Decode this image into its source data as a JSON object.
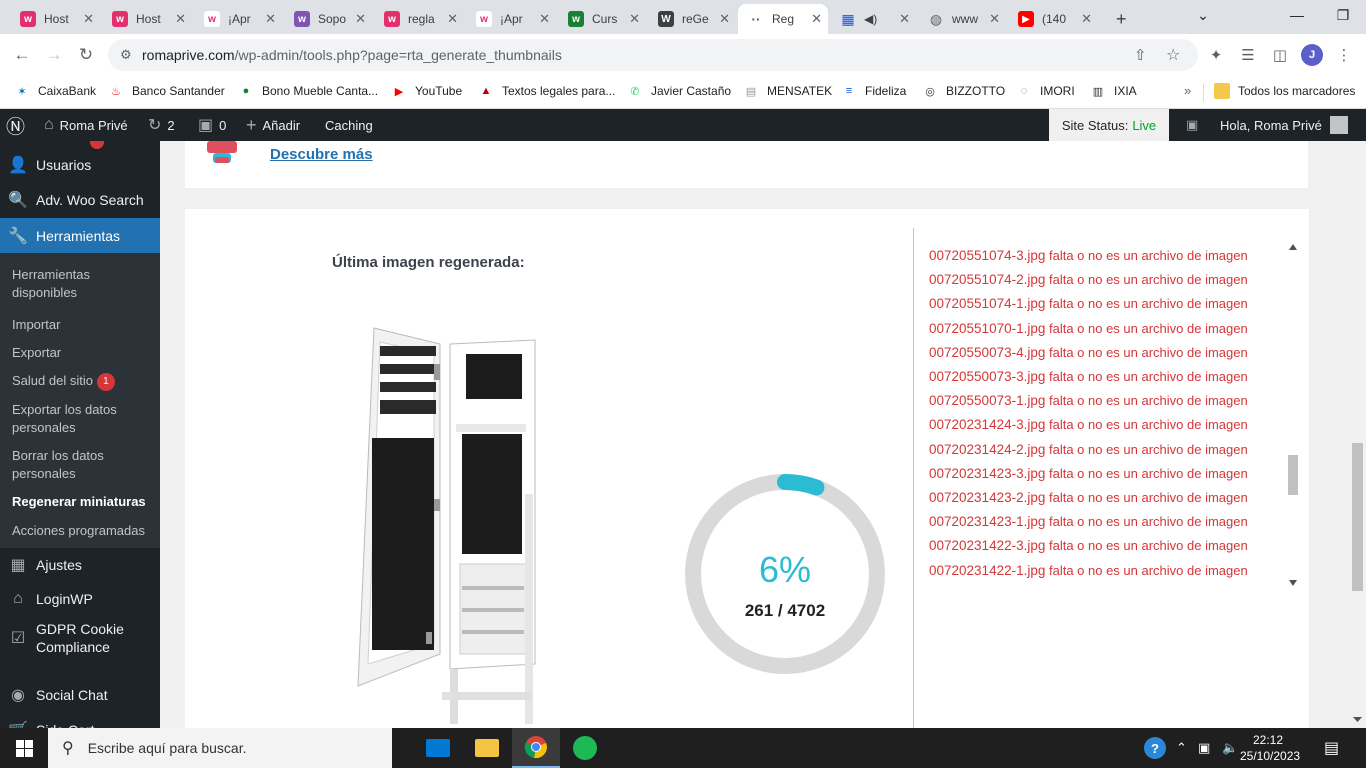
{
  "browser": {
    "tabs": [
      {
        "label": "Host",
        "favicon": "woo-icon",
        "color": "#e1306c"
      },
      {
        "label": "Host",
        "favicon": "woo-icon",
        "color": "#e1306c"
      },
      {
        "label": "¡Apr",
        "favicon": "woo-icon",
        "color": "#ffffff"
      },
      {
        "label": "Sopo",
        "favicon": "woo-icon",
        "color": "#7f54b3"
      },
      {
        "label": "regla",
        "favicon": "woo-icon",
        "color": "#e1306c"
      },
      {
        "label": "¡Apr",
        "favicon": "woo-icon",
        "color": "#ffffff"
      },
      {
        "label": "Curs",
        "favicon": "woo-icon",
        "color": "#1a7f37"
      },
      {
        "label": "reGe",
        "favicon": "wordpress-icon",
        "color": "#3c4043"
      },
      {
        "label": "Reg",
        "favicon": "loading-icon",
        "color": "#ffffff",
        "active": true
      },
      {
        "label": "",
        "favicon": "grid-icon",
        "color": "#1a56db"
      },
      {
        "label": "www",
        "favicon": "globe-icon",
        "color": "#5f6368"
      },
      {
        "label": "(140",
        "favicon": "youtube-icon",
        "color": "#ff0000"
      }
    ],
    "url_host": "romaprive.com",
    "url_path": "/wp-admin/tools.php?page=rta_generate_thumbnails"
  },
  "bookmarks": [
    {
      "label": "CaixaBank",
      "icon": "caixabank-icon",
      "color": "#0070b8"
    },
    {
      "label": "Banco Santander",
      "icon": "santander-icon",
      "color": "#ec0000"
    },
    {
      "label": "Bono Mueble Canta...",
      "icon": "bono-icon",
      "color": "#1a7f37"
    },
    {
      "label": "YouTube",
      "icon": "youtube-icon",
      "color": "#ff0000"
    },
    {
      "label": "Textos legales para...",
      "icon": "legal-icon",
      "color": "#c00000"
    },
    {
      "label": "Javier Castaño",
      "icon": "whatsapp-icon",
      "color": "#25d366"
    },
    {
      "label": "MENSATEK",
      "icon": "mensatek-icon",
      "color": "#999999"
    },
    {
      "label": "Fideliza",
      "icon": "fideliza-icon",
      "color": "#1a56db"
    },
    {
      "label": "BIZZOTTO",
      "icon": "bizzotto-icon",
      "color": "#333333"
    },
    {
      "label": "IMORI",
      "icon": "imori-icon",
      "color": "#666666"
    },
    {
      "label": "IXIA",
      "icon": "ixia-icon",
      "color": "#333333"
    }
  ],
  "bookmarks_all": "Todos los marcadores",
  "adminbar": {
    "site_name": "Roma Privé",
    "updates": "2",
    "comments": "0",
    "add_new": "Añadir",
    "caching": "Caching",
    "site_status_label": "Site Status:",
    "site_status_value": "Live",
    "greeting": "Hola, Roma Privé"
  },
  "sidebar": {
    "items": [
      {
        "label": "Usuarios",
        "icon": "users-icon"
      },
      {
        "label": "Adv. Woo Search",
        "icon": "search-icon"
      },
      {
        "label": "Herramientas",
        "icon": "wrench-icon",
        "current": true
      },
      {
        "label": "Ajustes",
        "icon": "settings-icon"
      },
      {
        "label": "LoginWP",
        "icon": "home-icon"
      },
      {
        "label": "GDPR Cookie Compliance",
        "icon": "shield-check-icon"
      },
      {
        "label": "Social Chat",
        "icon": "chat-icon"
      },
      {
        "label": "Side Cart",
        "icon": "cart-icon"
      }
    ],
    "submenu": [
      {
        "label": "Herramientas disponibles"
      },
      {
        "label": "Importar"
      },
      {
        "label": "Exportar"
      },
      {
        "label": "Salud del sitio",
        "badge": "1"
      },
      {
        "label": "Exportar los datos personales"
      },
      {
        "label": "Borrar los datos personales"
      },
      {
        "label": "Regenerar miniaturas",
        "current": true
      },
      {
        "label": "Acciones programadas"
      }
    ]
  },
  "promo": {
    "link": "Descubre más"
  },
  "regen": {
    "last_image_label": "Última imagen regenerada:",
    "percent_text": "6%",
    "percent": 6,
    "done": 261,
    "total": 4702,
    "counter_text": "261 / 4702",
    "accent": "#2bbbd3"
  },
  "log": {
    "error_suffix": "falta o no es un archivo de imagen",
    "files": [
      "00720551074-3.jpg",
      "00720551074-2.jpg",
      "00720551074-1.jpg",
      "00720551070-1.jpg",
      "00720550073-4.jpg",
      "00720550073-3.jpg",
      "00720550073-1.jpg",
      "00720231424-3.jpg",
      "00720231424-2.jpg",
      "00720231423-3.jpg",
      "00720231423-2.jpg",
      "00720231423-1.jpg",
      "00720231422-3.jpg",
      "00720231422-1.jpg"
    ],
    "color": "#d63638"
  },
  "taskbar": {
    "search_placeholder": "Escribe aquí para buscar.",
    "time": "22:12",
    "date": "25/10/2023"
  }
}
